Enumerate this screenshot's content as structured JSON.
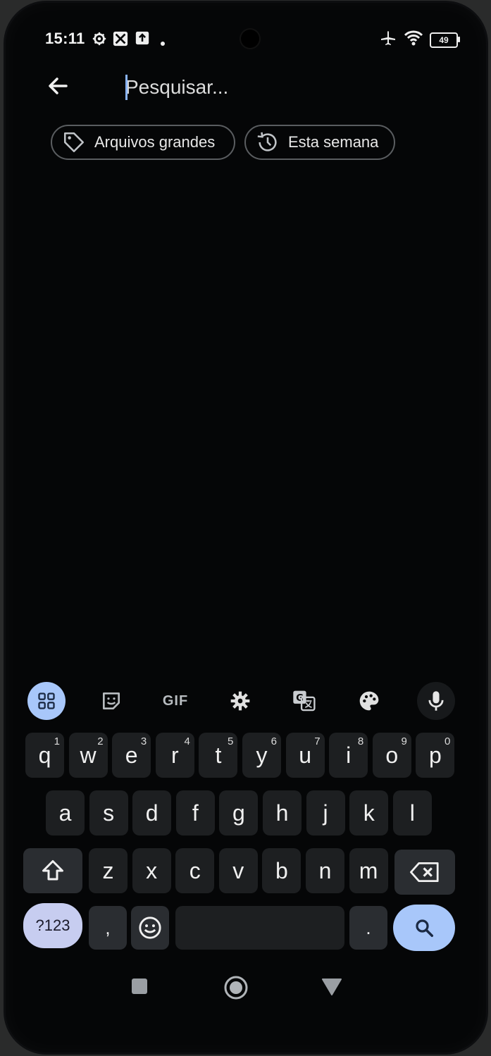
{
  "status_bar": {
    "time": "15:11",
    "battery": "49",
    "icons": [
      "settings-gear-icon",
      "app-notification-icon",
      "upload-icon",
      "dot-icon",
      "airplane-mode-icon",
      "wifi-icon",
      "battery-icon"
    ]
  },
  "search": {
    "placeholder": "Pesquisar..."
  },
  "chips": [
    {
      "label": "Arquivos grandes",
      "icon": "tag-icon"
    },
    {
      "label": "Esta semana",
      "icon": "history-icon"
    }
  ],
  "keyboard": {
    "toolbar": [
      "apps-grid-icon",
      "sticker-icon",
      "GIF",
      "settings-gear-icon",
      "translate-icon",
      "palette-icon",
      "microphone-icon"
    ],
    "gif_label": "GIF",
    "row1": [
      {
        "k": "q",
        "n": "1"
      },
      {
        "k": "w",
        "n": "2"
      },
      {
        "k": "e",
        "n": "3"
      },
      {
        "k": "r",
        "n": "4"
      },
      {
        "k": "t",
        "n": "5"
      },
      {
        "k": "y",
        "n": "6"
      },
      {
        "k": "u",
        "n": "7"
      },
      {
        "k": "i",
        "n": "8"
      },
      {
        "k": "o",
        "n": "9"
      },
      {
        "k": "p",
        "n": "0"
      }
    ],
    "row2": [
      "a",
      "s",
      "d",
      "f",
      "g",
      "h",
      "j",
      "k",
      "l"
    ],
    "row3": [
      "z",
      "x",
      "c",
      "v",
      "b",
      "n",
      "m"
    ],
    "symbols_label": "?123",
    "comma": ",",
    "period": "."
  },
  "colors": {
    "accent": "#a8c7fa",
    "background": "#050607",
    "key": "#1d1f21"
  }
}
